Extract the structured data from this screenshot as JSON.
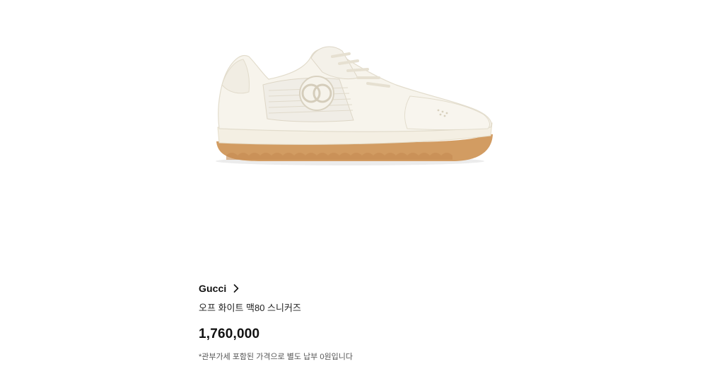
{
  "product": {
    "image_icon": "sneaker-product-image",
    "brand": "Gucci",
    "brand_link_icon": "chevron-right-icon",
    "name": "오프 화이트 맥80 스니커즈",
    "price": "1,760,000",
    "tax_note": "*관부가세 포함된 가격으로 별도 납부 0원입니다"
  }
}
